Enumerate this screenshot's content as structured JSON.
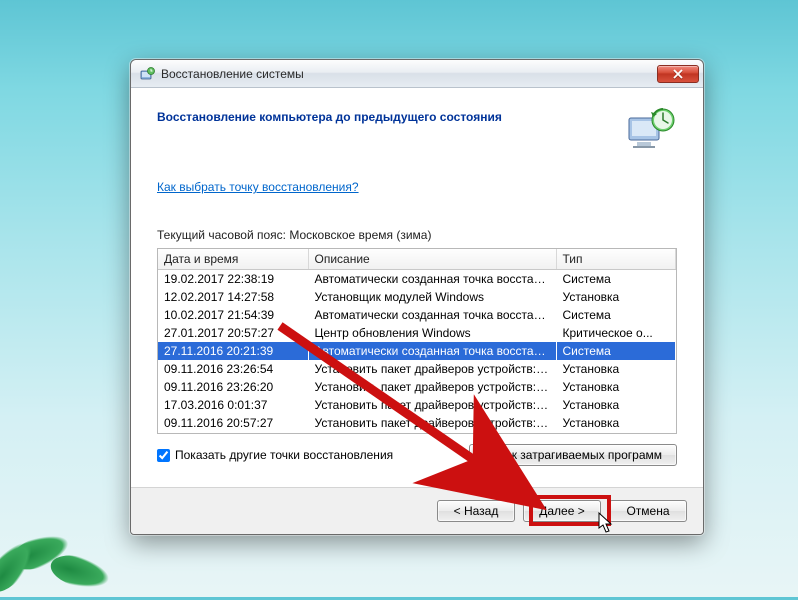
{
  "window": {
    "title": "Восстановление системы"
  },
  "heading": "Восстановление компьютера до предыдущего состояния",
  "help_link": "Как выбрать точку восстановления?",
  "timezone_label": "Текущий часовой пояс: Московское время (зима)",
  "columns": {
    "date": "Дата и время",
    "desc": "Описание",
    "type": "Тип"
  },
  "rows": [
    {
      "date": "19.02.2017 22:38:19",
      "desc": "Автоматически созданная точка восстанов...",
      "type": "Система",
      "selected": false
    },
    {
      "date": "12.02.2017 14:27:58",
      "desc": "Установщик модулей Windows",
      "type": "Установка",
      "selected": false
    },
    {
      "date": "10.02.2017 21:54:39",
      "desc": "Автоматически созданная точка восстанов...",
      "type": "Система",
      "selected": false
    },
    {
      "date": "27.01.2017 20:57:27",
      "desc": "Центр обновления Windows",
      "type": "Критическое о...",
      "selected": false
    },
    {
      "date": "27.11.2016 20:21:39",
      "desc": "Автоматически созданная точка восстанов...",
      "type": "Система",
      "selected": true
    },
    {
      "date": "09.11.2016 23:26:54",
      "desc": "Установить пакет драйверов устройств: Ог...",
      "type": "Установка",
      "selected": false
    },
    {
      "date": "09.11.2016 23:26:20",
      "desc": "Установить пакет драйверов устройств: Ог...",
      "type": "Установка",
      "selected": false
    },
    {
      "date": "17.03.2016 0:01:37",
      "desc": "Установить пакет драйверов устройств: Ог...",
      "type": "Установка",
      "selected": false
    },
    {
      "date": "09.11.2016 20:57:27",
      "desc": "Установить пакет драйверов устройств: Ог...",
      "type": "Установка",
      "selected": false
    }
  ],
  "show_more": "Показать другие точки восстановления",
  "scan_button": "Поиск затрагиваемых программ",
  "buttons": {
    "back": "< Назад",
    "next": "Далее >",
    "cancel": "Отмена"
  }
}
